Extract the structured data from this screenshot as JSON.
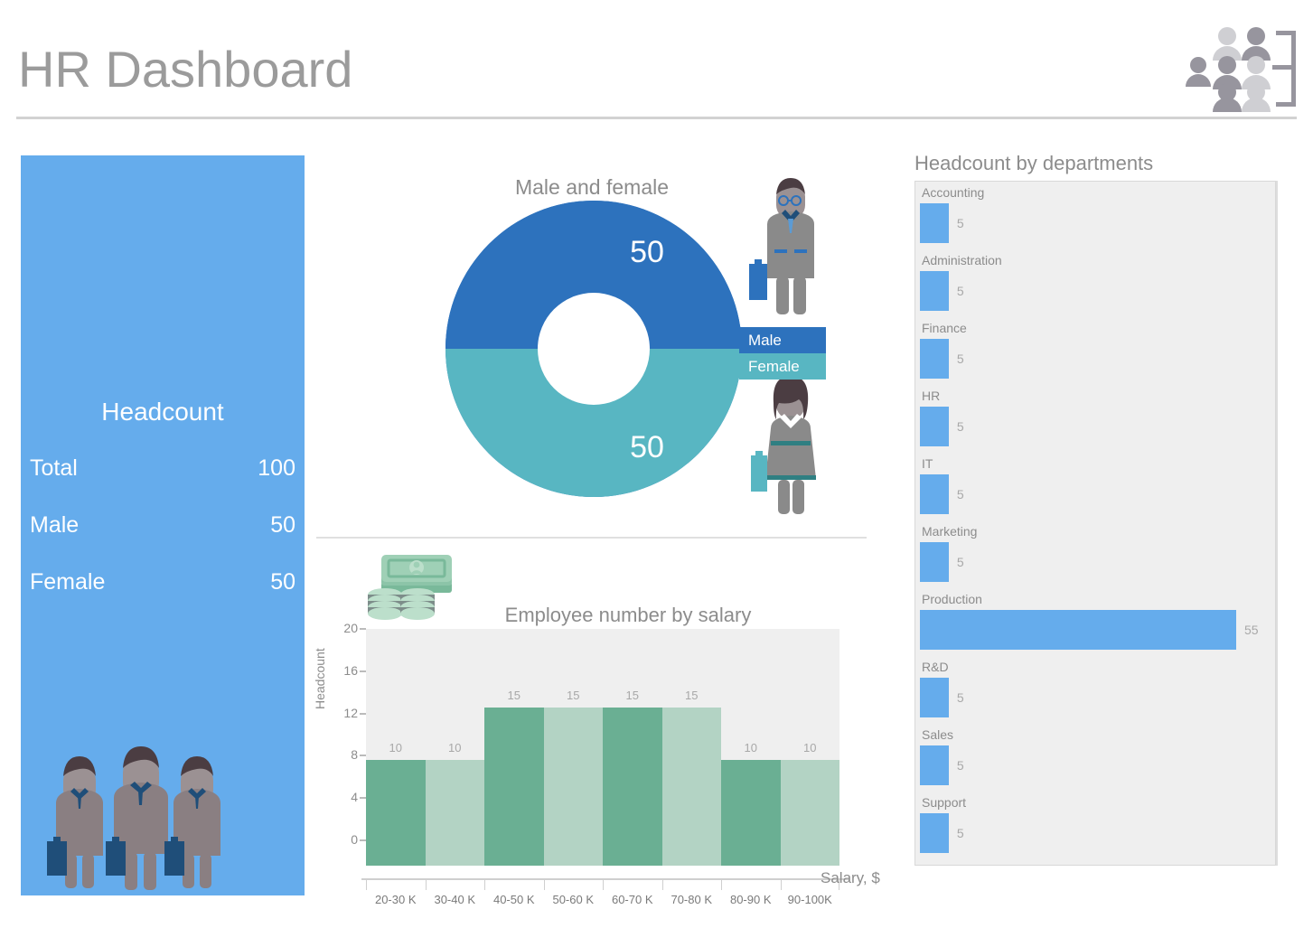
{
  "header": {
    "title": "HR Dashboard",
    "logo_icon": "org-people-icon"
  },
  "headcount_panel": {
    "title": "Headcount",
    "rows": [
      {
        "label": "Total",
        "value": "100"
      },
      {
        "label": "Male",
        "value": "50"
      },
      {
        "label": "Female",
        "value": "50"
      }
    ],
    "icon": "businessmen-group-icon",
    "background_color": "#65acec"
  },
  "gender_chart": {
    "title": "Male and female",
    "legend": [
      {
        "label": "Male",
        "color": "#2d72bd"
      },
      {
        "label": "Female",
        "color": "#58b6c2"
      }
    ],
    "male_value": "50",
    "female_value": "50",
    "male_icon": "male-employee-icon",
    "female_icon": "female-employee-icon"
  },
  "salary_chart": {
    "title": "Employee number by salary",
    "ylabel": "Headcount",
    "xlabel": "Salary, $",
    "icon": "money-icon",
    "y_ticks": [
      "20",
      "16",
      "12",
      "8",
      "4",
      "0"
    ]
  },
  "departments_panel": {
    "title": "Headcount by departments",
    "bar_color": "#65acec"
  },
  "chart_data": [
    {
      "type": "pie",
      "title": "Male and female",
      "labels": [
        "Male",
        "Female"
      ],
      "values": [
        50,
        50
      ],
      "colors": [
        "#2d72bd",
        "#58b6c2"
      ],
      "donut": true,
      "legend": "right"
    },
    {
      "type": "bar",
      "title": "Employee number by salary",
      "categories": [
        "20-30 K",
        "30-40 K",
        "40-50 K",
        "50-60 K",
        "60-70 K",
        "70-80 K",
        "80-90 K",
        "90-100K"
      ],
      "values": [
        10,
        10,
        15,
        15,
        15,
        15,
        10,
        10
      ],
      "bar_colors": [
        "#6aaf93",
        "#b3d3c4",
        "#6aaf93",
        "#b3d3c4",
        "#6aaf93",
        "#b3d3c4",
        "#6aaf93",
        "#b3d3c4"
      ],
      "xlabel": "Salary, $",
      "ylabel": "Headcount",
      "ylim": [
        0,
        20
      ],
      "yticks": [
        0,
        4,
        8,
        12,
        16,
        20
      ],
      "grid": false,
      "legend": "none"
    },
    {
      "type": "bar",
      "orientation": "horizontal",
      "title": "Headcount by departments",
      "categories": [
        "Accounting",
        "Administration",
        "Finance",
        "HR",
        "IT",
        "Marketing",
        "Production",
        "R&D",
        "Sales",
        "Support"
      ],
      "values": [
        5,
        5,
        5,
        5,
        5,
        5,
        55,
        5,
        5,
        5
      ],
      "xlim": [
        0,
        55
      ],
      "grid": false,
      "legend": "none"
    }
  ]
}
